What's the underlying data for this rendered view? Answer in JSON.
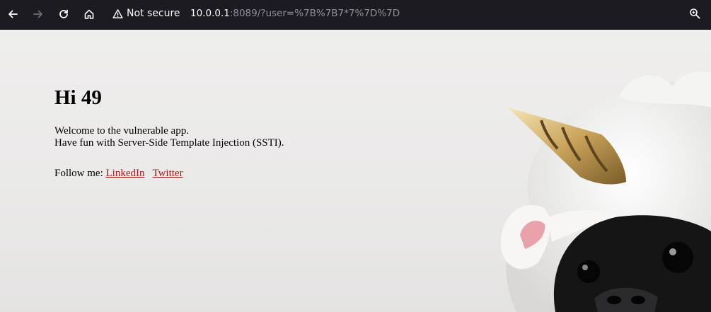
{
  "browser": {
    "security_label": "Not secure",
    "url_host": "10.0.0.1",
    "url_rest": ":8089/?user=%7B%7B7*7%7D%7D"
  },
  "page": {
    "title": "Hi 49",
    "line1": "Welcome to the vulnerable app.",
    "line2": "Have fun with Server-Side Template Injection (SSTI).",
    "follow_label": "Follow me:",
    "links": [
      "LinkedIn",
      "Twitter"
    ]
  },
  "colors": {
    "toolbar_bg": "#1c1b22",
    "page_bg": "#ececeb",
    "link": "#9b1c1c"
  },
  "icons": [
    "back-icon",
    "forward-icon",
    "reload-icon",
    "home-icon",
    "warning-icon",
    "zoom-icon"
  ]
}
